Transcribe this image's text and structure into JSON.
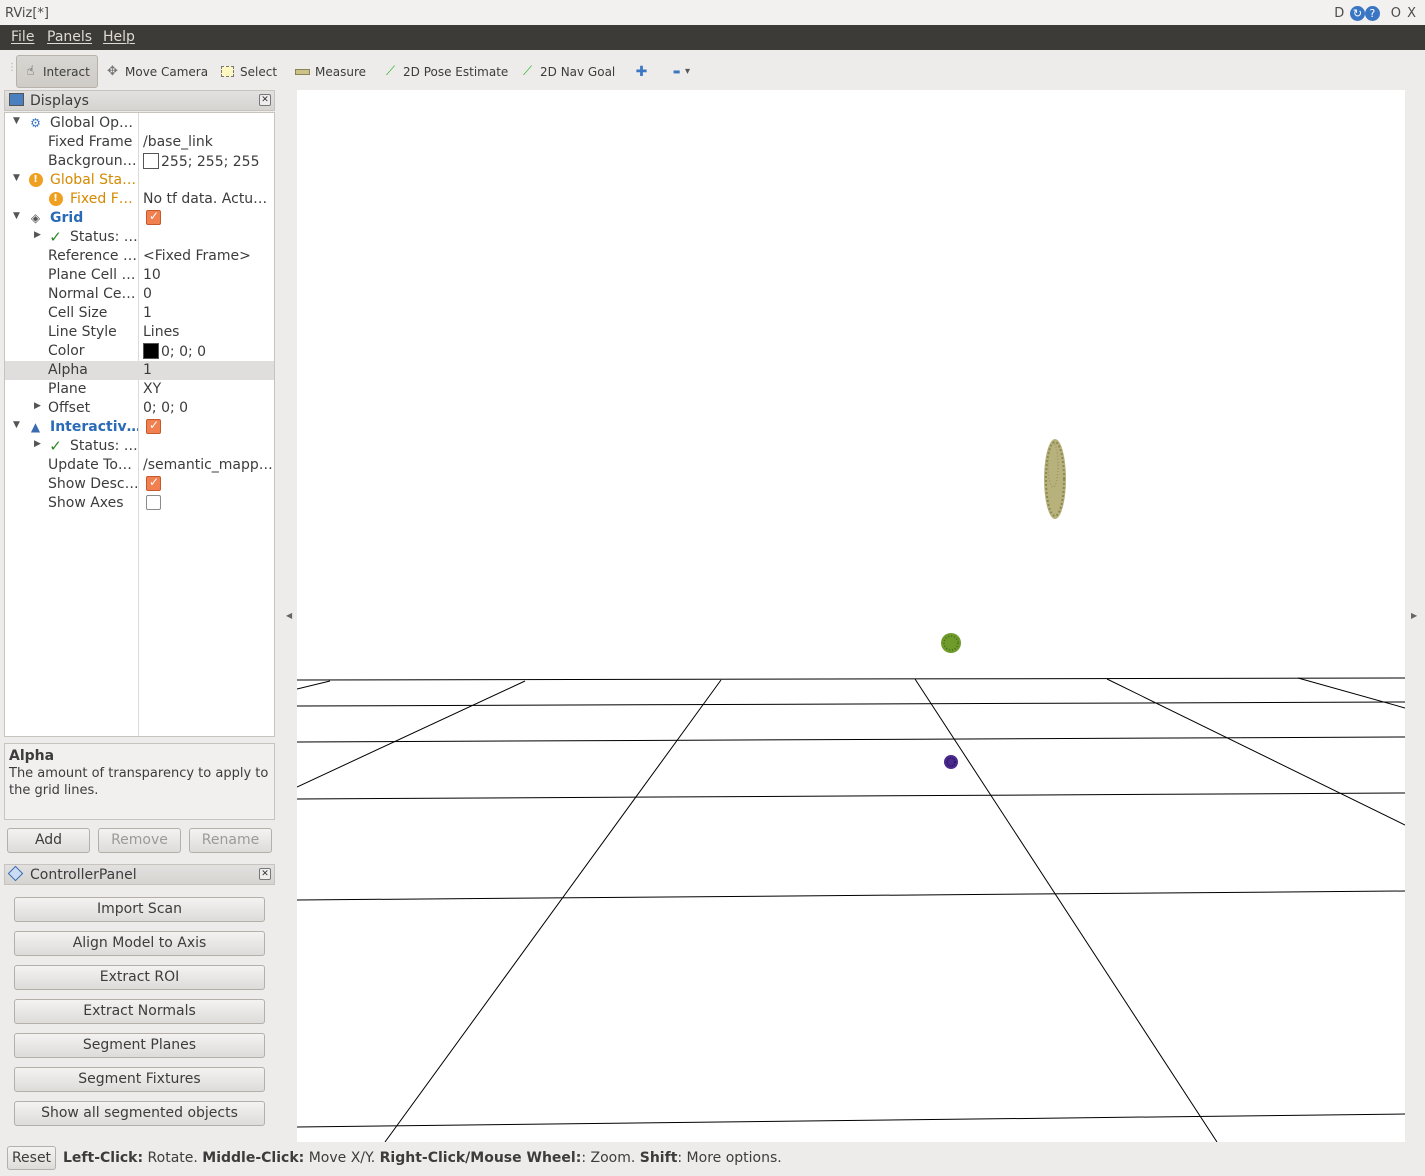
{
  "window": {
    "title": "RViz[*]",
    "controls": [
      "D",
      "C",
      "?",
      "O",
      "X"
    ]
  },
  "menu": [
    "File",
    "Panels",
    "Help"
  ],
  "toolbar": {
    "tools": [
      {
        "label": "Interact",
        "icon": "hand-cursor-icon",
        "active": true
      },
      {
        "label": "Move Camera",
        "icon": "move-camera-icon"
      },
      {
        "label": "Select",
        "icon": "select-box-icon"
      },
      {
        "label": "Measure",
        "icon": "ruler-icon"
      },
      {
        "label": "2D Pose Estimate",
        "icon": "green-arrow-icon"
      },
      {
        "label": "2D Nav Goal",
        "icon": "green-arrow-icon"
      }
    ],
    "add_symbol": "✚",
    "remove_symbol": "▬",
    "dropdown_symbol": "▾"
  },
  "displays": {
    "title": "Displays",
    "rows": [
      {
        "name": "Global Op…",
        "value": ""
      },
      {
        "name": "Fixed Frame",
        "value": "/base_link"
      },
      {
        "name": "Backgroun…",
        "value": "255; 255; 255",
        "swatch": "#ffffff"
      },
      {
        "name": "Global Sta…",
        "value": ""
      },
      {
        "name": "Fixed F…",
        "value": "No tf data.  Actu…"
      },
      {
        "name": "Grid",
        "value": "",
        "checked": true
      },
      {
        "name": "Status: …",
        "value": ""
      },
      {
        "name": "Reference …",
        "value": "<Fixed Frame>"
      },
      {
        "name": "Plane Cell …",
        "value": "10"
      },
      {
        "name": "Normal Ce…",
        "value": "0"
      },
      {
        "name": "Cell Size",
        "value": "1"
      },
      {
        "name": "Line Style",
        "value": "Lines"
      },
      {
        "name": "Color",
        "value": "0; 0; 0",
        "swatch": "#000000"
      },
      {
        "name": "Alpha",
        "value": "1",
        "selected": true
      },
      {
        "name": "Plane",
        "value": "XY"
      },
      {
        "name": "Offset",
        "value": "0; 0; 0"
      },
      {
        "name": "Interactiv…",
        "value": "",
        "checked": true
      },
      {
        "name": "Status: …",
        "value": ""
      },
      {
        "name": "Update To…",
        "value": "/semantic_mapp…"
      },
      {
        "name": "Show Desc…",
        "value": "",
        "checked": true
      },
      {
        "name": "Show Axes",
        "value": "",
        "checked": false
      }
    ]
  },
  "description": {
    "title": "Alpha",
    "text": "The amount of transparency to apply to the grid lines."
  },
  "display_buttons": {
    "add": "Add",
    "remove": "Remove",
    "rename": "Rename"
  },
  "controller": {
    "title": "ControllerPanel",
    "buttons": [
      "Import Scan",
      "Align Model to Axis",
      "Extract ROI",
      "Extract Normals",
      "Segment Planes",
      "Segment Fixtures",
      "Show all segmented objects"
    ]
  },
  "status": {
    "reset": "Reset",
    "parts": [
      {
        "bold": "Left-Click:",
        "text": " Rotate. "
      },
      {
        "bold": "Middle-Click:",
        "text": " Move X/Y. "
      },
      {
        "bold": "Right-Click/Mouse Wheel:",
        "text": ": Zoom. "
      },
      {
        "bold": "Shift",
        "text": ": More options."
      }
    ]
  },
  "colors": {
    "menubar": "#3c3b37",
    "accent_orange": "#f08050",
    "warning": "#d58a00",
    "link_blue": "#2a6bb7",
    "object_tan": "#a8a26a",
    "object_green": "#5d8a1e",
    "object_purple": "#4b2a8c"
  }
}
